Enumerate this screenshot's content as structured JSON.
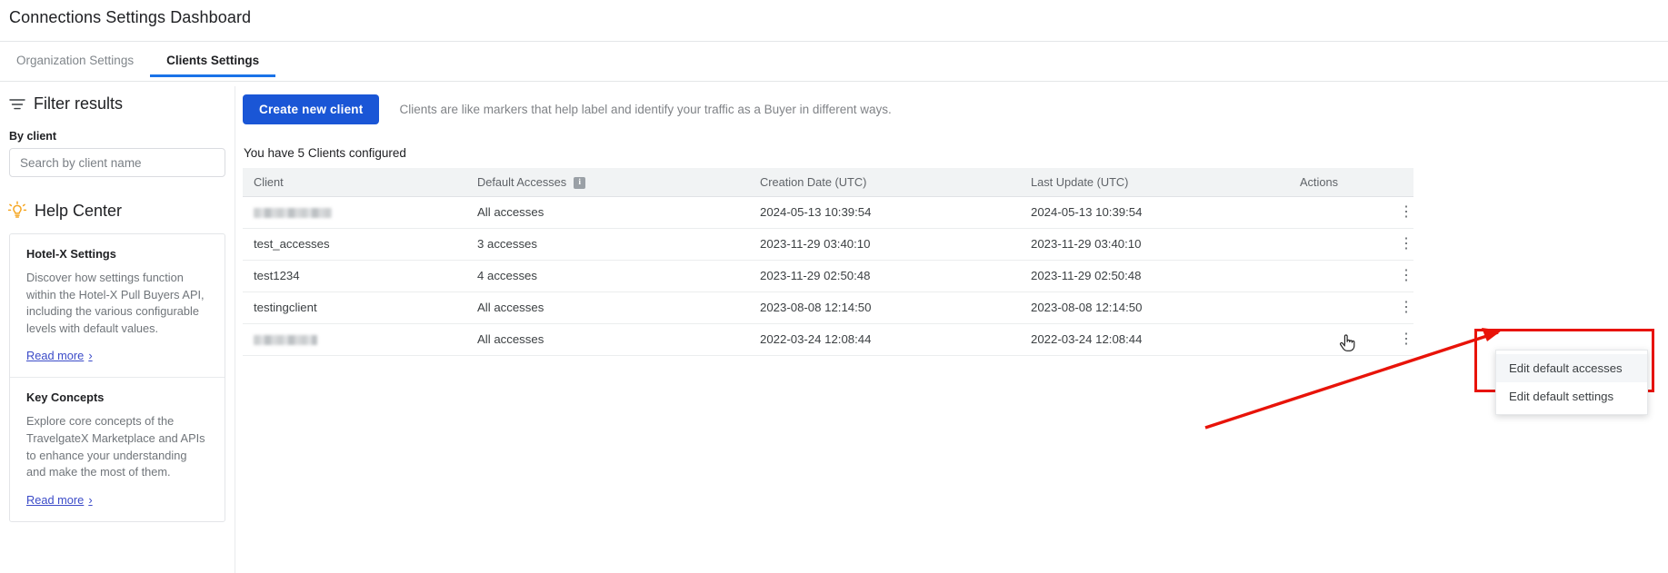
{
  "header": {
    "title": "Connections Settings Dashboard"
  },
  "tabs": [
    {
      "label": "Organization Settings",
      "active": false
    },
    {
      "label": "Clients Settings",
      "active": true
    }
  ],
  "sidebar": {
    "filter": {
      "title": "Filter results",
      "icon": "filter-icon",
      "by_client_label": "By client",
      "search_placeholder": "Search by client name",
      "search_value": ""
    },
    "help_center": {
      "title": "Help Center",
      "icon": "lightbulb-icon",
      "items": [
        {
          "title": "Hotel-X Settings",
          "body": "Discover how settings function within the Hotel-X Pull Buyers API, including the various configurable levels with default values.",
          "link": "Read more",
          "chevron": "›"
        },
        {
          "title": "Key Concepts",
          "body": "Explore core concepts of the TravelgateX Marketplace and APIs to enhance your understanding and make the most of them.",
          "link": "Read more",
          "chevron": "›"
        }
      ]
    }
  },
  "main": {
    "create_button": "Create new client",
    "description": "Clients are like markers that help label and identify your traffic as a Buyer in different ways.",
    "count_text": "You have 5 Clients configured",
    "table": {
      "columns": [
        "Client",
        "Default Accesses",
        "Creation Date (UTC)",
        "Last Update (UTC)",
        "Actions"
      ],
      "info_badge": "i",
      "kebab_glyph": "⋮",
      "rows": [
        {
          "client": "",
          "redacted": true,
          "redacted_width": 86,
          "accesses": "All accesses",
          "created": "2024-05-13 10:39:54",
          "updated": "2024-05-13 10:39:54"
        },
        {
          "client": "test_accesses",
          "redacted": false,
          "accesses": "3 accesses",
          "created": "2023-11-29 03:40:10",
          "updated": "2023-11-29 03:40:10"
        },
        {
          "client": "test1234",
          "redacted": false,
          "accesses": "4 accesses",
          "created": "2023-11-29 02:50:48",
          "updated": "2023-11-29 02:50:48"
        },
        {
          "client": "testingclient",
          "redacted": false,
          "accesses": "All accesses",
          "created": "2023-08-08 12:14:50",
          "updated": "2023-08-08 12:14:50"
        },
        {
          "client": "",
          "redacted": true,
          "redacted_width": 70,
          "accesses": "All accesses",
          "created": "2022-03-24 12:08:44",
          "updated": "2022-03-24 12:08:44"
        }
      ]
    }
  },
  "context_menu": {
    "items": [
      "Edit default accesses",
      "Edit default settings"
    ],
    "hovered_index": 0
  },
  "annotation": {
    "color": "#e81309",
    "shape": "rectangle-with-arrow"
  }
}
